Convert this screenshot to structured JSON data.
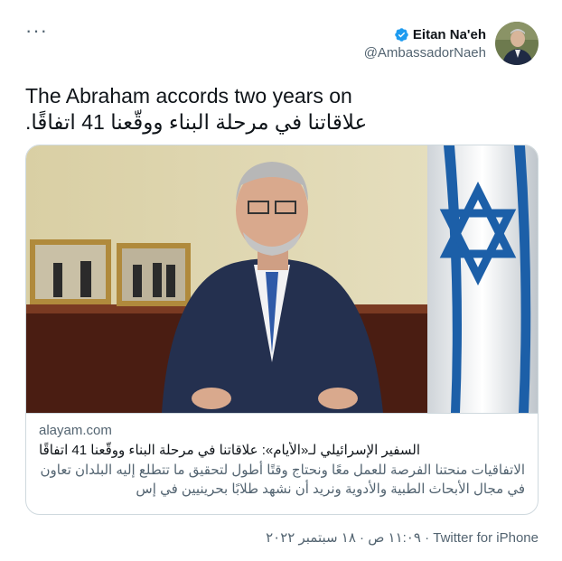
{
  "menu": {
    "icon": "more-horizontal-icon",
    "label": "···"
  },
  "author": {
    "name": "Eitan Na'eh",
    "handle": "@AmbassadorNaeh",
    "verified_icon": "verified-badge-icon",
    "verified_color": "#1d9bf0"
  },
  "tweet": {
    "line1": "The Abraham accords two years on",
    "line2": "علاقاتنا في مرحلة البناء ووقّعنا 41 اتفاقًا."
  },
  "card": {
    "domain": "alayam.com",
    "title": "السفير الإسرائيلي لـ«الأيام»: علاقاتنا في مرحلة البناء ووقّعنا 41 اتفاقًا",
    "description_line1": "الاتفاقيات منحتنا الفرصة للعمل معًا ونحتاج وقتًا أطول لتحقيق ما تتطلع إليه البلدان تعاون",
    "description_line2": "في مجال الأبحاث الطبية والأدوية ونريد أن نشهد طلابًا بحرينيين في إس"
  },
  "meta": {
    "text": "١١:٠٩ ص · ١٨ سبتمبر ٢٠٢٢ · Twitter for iPhone"
  }
}
